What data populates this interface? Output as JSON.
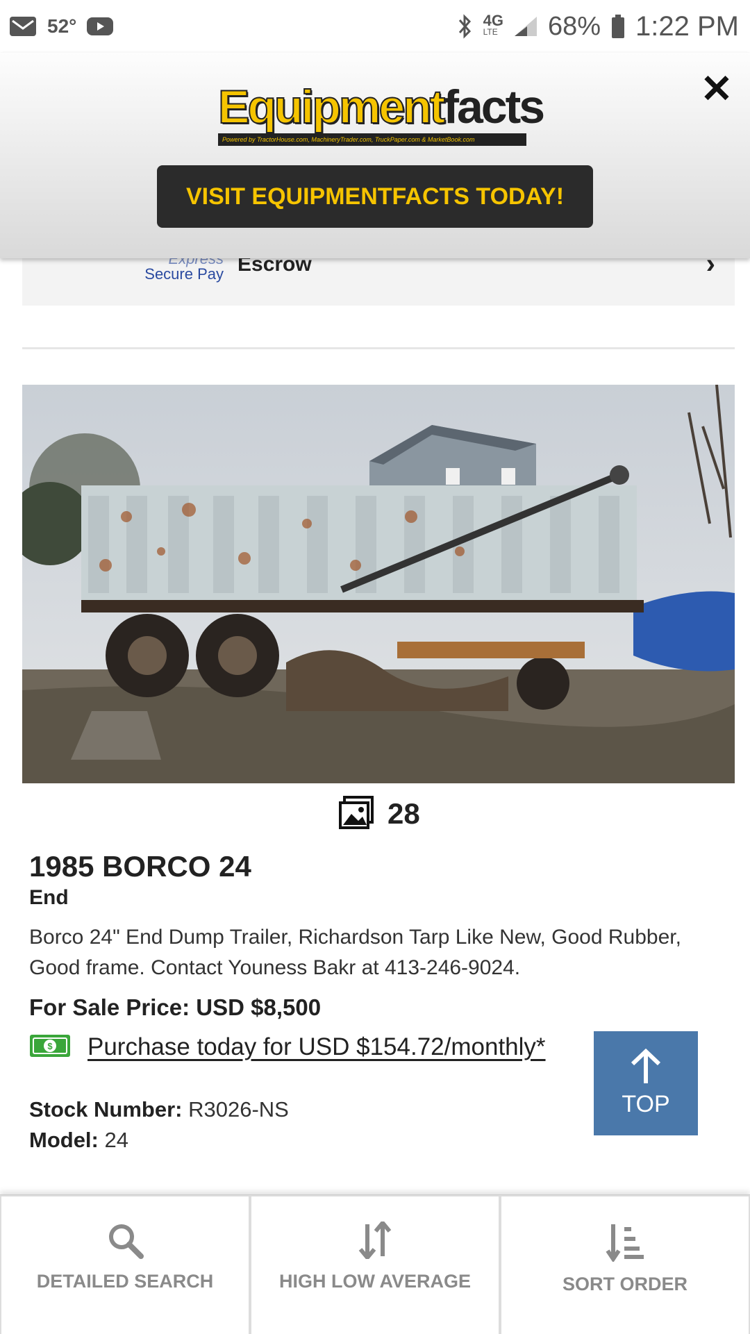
{
  "status_bar": {
    "temperature": "52°",
    "network": "4G",
    "network_sub": "LTE",
    "battery": "68%",
    "time": "1:22 PM"
  },
  "ad": {
    "logo_primary": "Equipment",
    "logo_secondary": "facts",
    "logo_tagline": "Powered by TractorHouse.com, MachineryTrader.com, TruckPaper.com & MarketBook.com",
    "cta_label": "VISIT EQUIPMENTFACTS TODAY!",
    "close_icon": "close-icon"
  },
  "escrow": {
    "logo_top": "Express",
    "logo_bottom": "Secure Pay",
    "label": "Escrow"
  },
  "listing": {
    "photo_count": "28",
    "title": "1985 BORCO 24",
    "subtitle": "End",
    "description": "Borco 24\" End Dump Trailer, Richardson Tarp Like New, Good Rubber, Good frame. Contact Youness Bakr at 413-246-9024.",
    "price_label": "For Sale Price:",
    "price_value": "USD $8,500",
    "finance_link": "Purchase today for USD $154.72/monthly*",
    "stock_label": "Stock Number:",
    "stock_value": "R3026-NS",
    "model_label": "Model:",
    "model_value": "24"
  },
  "top_button": {
    "label": "TOP"
  },
  "bottom_nav": [
    {
      "label": "DETAILED SEARCH",
      "icon": "search-icon"
    },
    {
      "label": "HIGH LOW AVERAGE",
      "icon": "high-low-icon"
    },
    {
      "label": "SORT ORDER",
      "icon": "sort-icon"
    }
  ],
  "colors": {
    "brand_yellow": "#f5c400",
    "cta_background": "#2b2b2b",
    "top_button": "#4a78aa",
    "nav_text": "#8a8a8a"
  }
}
